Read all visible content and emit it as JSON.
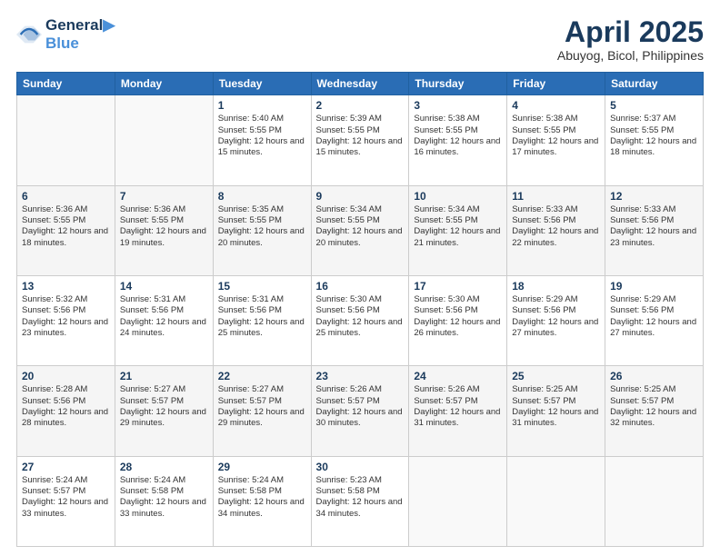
{
  "header": {
    "logo_line1": "General",
    "logo_line2": "Blue",
    "title": "April 2025",
    "subtitle": "Abuyog, Bicol, Philippines"
  },
  "days_of_week": [
    "Sunday",
    "Monday",
    "Tuesday",
    "Wednesday",
    "Thursday",
    "Friday",
    "Saturday"
  ],
  "weeks": [
    [
      {
        "day": "",
        "info": ""
      },
      {
        "day": "",
        "info": ""
      },
      {
        "day": "1",
        "info": "Sunrise: 5:40 AM\nSunset: 5:55 PM\nDaylight: 12 hours and 15 minutes."
      },
      {
        "day": "2",
        "info": "Sunrise: 5:39 AM\nSunset: 5:55 PM\nDaylight: 12 hours and 15 minutes."
      },
      {
        "day": "3",
        "info": "Sunrise: 5:38 AM\nSunset: 5:55 PM\nDaylight: 12 hours and 16 minutes."
      },
      {
        "day": "4",
        "info": "Sunrise: 5:38 AM\nSunset: 5:55 PM\nDaylight: 12 hours and 17 minutes."
      },
      {
        "day": "5",
        "info": "Sunrise: 5:37 AM\nSunset: 5:55 PM\nDaylight: 12 hours and 18 minutes."
      }
    ],
    [
      {
        "day": "6",
        "info": "Sunrise: 5:36 AM\nSunset: 5:55 PM\nDaylight: 12 hours and 18 minutes."
      },
      {
        "day": "7",
        "info": "Sunrise: 5:36 AM\nSunset: 5:55 PM\nDaylight: 12 hours and 19 minutes."
      },
      {
        "day": "8",
        "info": "Sunrise: 5:35 AM\nSunset: 5:55 PM\nDaylight: 12 hours and 20 minutes."
      },
      {
        "day": "9",
        "info": "Sunrise: 5:34 AM\nSunset: 5:55 PM\nDaylight: 12 hours and 20 minutes."
      },
      {
        "day": "10",
        "info": "Sunrise: 5:34 AM\nSunset: 5:55 PM\nDaylight: 12 hours and 21 minutes."
      },
      {
        "day": "11",
        "info": "Sunrise: 5:33 AM\nSunset: 5:56 PM\nDaylight: 12 hours and 22 minutes."
      },
      {
        "day": "12",
        "info": "Sunrise: 5:33 AM\nSunset: 5:56 PM\nDaylight: 12 hours and 23 minutes."
      }
    ],
    [
      {
        "day": "13",
        "info": "Sunrise: 5:32 AM\nSunset: 5:56 PM\nDaylight: 12 hours and 23 minutes."
      },
      {
        "day": "14",
        "info": "Sunrise: 5:31 AM\nSunset: 5:56 PM\nDaylight: 12 hours and 24 minutes."
      },
      {
        "day": "15",
        "info": "Sunrise: 5:31 AM\nSunset: 5:56 PM\nDaylight: 12 hours and 25 minutes."
      },
      {
        "day": "16",
        "info": "Sunrise: 5:30 AM\nSunset: 5:56 PM\nDaylight: 12 hours and 25 minutes."
      },
      {
        "day": "17",
        "info": "Sunrise: 5:30 AM\nSunset: 5:56 PM\nDaylight: 12 hours and 26 minutes."
      },
      {
        "day": "18",
        "info": "Sunrise: 5:29 AM\nSunset: 5:56 PM\nDaylight: 12 hours and 27 minutes."
      },
      {
        "day": "19",
        "info": "Sunrise: 5:29 AM\nSunset: 5:56 PM\nDaylight: 12 hours and 27 minutes."
      }
    ],
    [
      {
        "day": "20",
        "info": "Sunrise: 5:28 AM\nSunset: 5:56 PM\nDaylight: 12 hours and 28 minutes."
      },
      {
        "day": "21",
        "info": "Sunrise: 5:27 AM\nSunset: 5:57 PM\nDaylight: 12 hours and 29 minutes."
      },
      {
        "day": "22",
        "info": "Sunrise: 5:27 AM\nSunset: 5:57 PM\nDaylight: 12 hours and 29 minutes."
      },
      {
        "day": "23",
        "info": "Sunrise: 5:26 AM\nSunset: 5:57 PM\nDaylight: 12 hours and 30 minutes."
      },
      {
        "day": "24",
        "info": "Sunrise: 5:26 AM\nSunset: 5:57 PM\nDaylight: 12 hours and 31 minutes."
      },
      {
        "day": "25",
        "info": "Sunrise: 5:25 AM\nSunset: 5:57 PM\nDaylight: 12 hours and 31 minutes."
      },
      {
        "day": "26",
        "info": "Sunrise: 5:25 AM\nSunset: 5:57 PM\nDaylight: 12 hours and 32 minutes."
      }
    ],
    [
      {
        "day": "27",
        "info": "Sunrise: 5:24 AM\nSunset: 5:57 PM\nDaylight: 12 hours and 33 minutes."
      },
      {
        "day": "28",
        "info": "Sunrise: 5:24 AM\nSunset: 5:58 PM\nDaylight: 12 hours and 33 minutes."
      },
      {
        "day": "29",
        "info": "Sunrise: 5:24 AM\nSunset: 5:58 PM\nDaylight: 12 hours and 34 minutes."
      },
      {
        "day": "30",
        "info": "Sunrise: 5:23 AM\nSunset: 5:58 PM\nDaylight: 12 hours and 34 minutes."
      },
      {
        "day": "",
        "info": ""
      },
      {
        "day": "",
        "info": ""
      },
      {
        "day": "",
        "info": ""
      }
    ]
  ]
}
